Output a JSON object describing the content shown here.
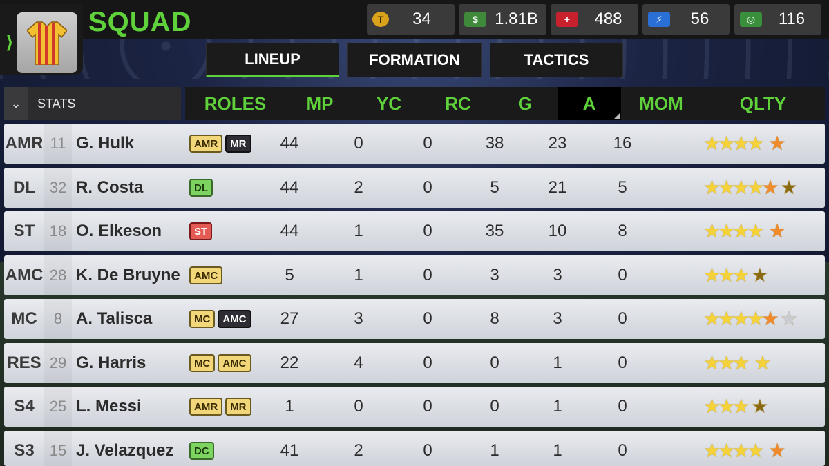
{
  "header": {
    "title": "SQUAD",
    "back_arrow": "⟩",
    "currencies": [
      {
        "icon": "token-icon",
        "symbol": "T",
        "value": "34",
        "bg": "#d9a21b"
      },
      {
        "icon": "cash-icon",
        "symbol": "$",
        "value": "1.81B",
        "bg": "#3f8a3a"
      },
      {
        "icon": "medical-icon",
        "symbol": "+",
        "value": "488",
        "bg": "#c8202c"
      },
      {
        "icon": "energy-icon",
        "symbol": "⚡",
        "value": "56",
        "bg": "#2a6fd6"
      },
      {
        "icon": "training-icon",
        "symbol": "◎",
        "value": "116",
        "bg": "#3a8f3a"
      }
    ]
  },
  "tabs": [
    {
      "label": "LINEUP",
      "active": true
    },
    {
      "label": "FORMATION",
      "active": false
    },
    {
      "label": "TACTICS",
      "active": false
    }
  ],
  "stats_dropdown": {
    "label": "STATS",
    "chevron": "⌄"
  },
  "columns": [
    "ROLES",
    "MP",
    "YC",
    "RC",
    "G",
    "A",
    "MOM",
    "QLTY"
  ],
  "sorted_column": "A",
  "role_colors": {
    "AMR": "#f1d67a",
    "MR": "#2d2d33",
    "DL": "#7dd35f",
    "ST": "#e45a55",
    "AMC": "#f1d67a",
    "MC": "#f1d67a",
    "DC": "#7dd35f"
  },
  "players": [
    {
      "pos": "AMR",
      "num": "11",
      "name": "G. Hulk",
      "roles": [
        {
          "code": "AMR",
          "style": "primary"
        },
        {
          "code": "MR",
          "style": "dark"
        }
      ],
      "mp": "44",
      "yc": "0",
      "rc": "0",
      "g": "38",
      "a": "23",
      "mom": "16",
      "stars": [
        "gold",
        "gold",
        "gold",
        "gold",
        "orange"
      ]
    },
    {
      "pos": "DL",
      "num": "32",
      "name": "R. Costa",
      "roles": [
        {
          "code": "DL",
          "style": "green"
        }
      ],
      "mp": "44",
      "yc": "2",
      "rc": "0",
      "g": "5",
      "a": "21",
      "mom": "5",
      "stars": [
        "gold",
        "gold",
        "gold",
        "gold",
        "orange",
        "half"
      ]
    },
    {
      "pos": "ST",
      "num": "18",
      "name": "O. Elkeson",
      "roles": [
        {
          "code": "ST",
          "style": "red"
        }
      ],
      "mp": "44",
      "yc": "1",
      "rc": "0",
      "g": "35",
      "a": "10",
      "mom": "8",
      "stars": [
        "gold",
        "gold",
        "gold",
        "gold",
        "orange"
      ]
    },
    {
      "pos": "AMC",
      "num": "28",
      "name": "K. De Bruyne",
      "roles": [
        {
          "code": "AMC",
          "style": "primary"
        }
      ],
      "mp": "5",
      "yc": "1",
      "rc": "0",
      "g": "3",
      "a": "3",
      "mom": "0",
      "stars": [
        "gold",
        "gold",
        "gold",
        "half"
      ]
    },
    {
      "pos": "MC",
      "num": "8",
      "name": "A. Talisca",
      "roles": [
        {
          "code": "MC",
          "style": "primary"
        },
        {
          "code": "AMC",
          "style": "dark"
        }
      ],
      "mp": "27",
      "yc": "3",
      "rc": "0",
      "g": "8",
      "a": "3",
      "mom": "0",
      "stars": [
        "gold",
        "gold",
        "gold",
        "gold",
        "orange",
        "grey"
      ]
    },
    {
      "pos": "RES",
      "num": "29",
      "name": "G. Harris",
      "roles": [
        {
          "code": "MC",
          "style": "primary"
        },
        {
          "code": "AMC",
          "style": "primary"
        }
      ],
      "mp": "22",
      "yc": "4",
      "rc": "0",
      "g": "0",
      "a": "1",
      "mom": "0",
      "stars": [
        "gold",
        "gold",
        "gold",
        "gold"
      ]
    },
    {
      "pos": "S4",
      "num": "25",
      "name": "L. Messi",
      "roles": [
        {
          "code": "AMR",
          "style": "primary"
        },
        {
          "code": "MR",
          "style": "primary"
        }
      ],
      "mp": "1",
      "yc": "0",
      "rc": "0",
      "g": "0",
      "a": "1",
      "mom": "0",
      "stars": [
        "gold",
        "gold",
        "gold",
        "half"
      ]
    },
    {
      "pos": "S3",
      "num": "15",
      "name": "J. Velazquez",
      "roles": [
        {
          "code": "DC",
          "style": "green"
        }
      ],
      "mp": "41",
      "yc": "2",
      "rc": "0",
      "g": "1",
      "a": "1",
      "mom": "0",
      "stars": [
        "gold",
        "gold",
        "gold",
        "gold",
        "orange"
      ]
    }
  ]
}
